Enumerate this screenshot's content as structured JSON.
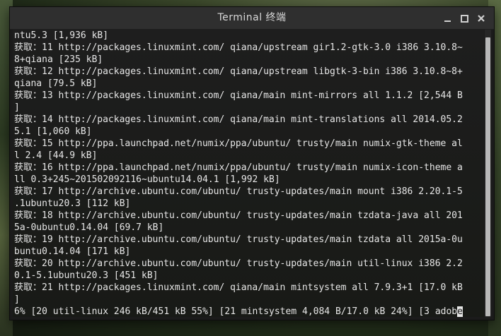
{
  "window": {
    "title": "Terminal 终端"
  },
  "terminal": {
    "lines": [
      "ntu5.3 [1,936 kB]",
      "获取：11 http://packages.linuxmint.com/ qiana/upstream gir1.2-gtk-3.0 i386 3.10.8~",
      "8+qiana [235 kB]",
      "获取：12 http://packages.linuxmint.com/ qiana/upstream libgtk-3-bin i386 3.10.8~8+",
      "qiana [79.5 kB]",
      "获取：13 http://packages.linuxmint.com/ qiana/main mint-mirrors all 1.1.2 [2,544 B",
      "]",
      "获取：14 http://packages.linuxmint.com/ qiana/main mint-translations all 2014.05.2",
      "5.1 [1,060 kB]",
      "获取：15 http://ppa.launchpad.net/numix/ppa/ubuntu/ trusty/main numix-gtk-theme al",
      "l 2.4 [44.9 kB]",
      "获取：16 http://ppa.launchpad.net/numix/ppa/ubuntu/ trusty/main numix-icon-theme a",
      "ll 0.3+245~201502092116~ubuntu14.04.1 [1,992 kB]",
      "获取：17 http://archive.ubuntu.com/ubuntu/ trusty-updates/main mount i386 2.20.1-5",
      ".1ubuntu20.3 [112 kB]",
      "获取：18 http://archive.ubuntu.com/ubuntu/ trusty-updates/main tzdata-java all 201",
      "5a-0ubuntu0.14.04 [69.7 kB]",
      "获取：19 http://archive.ubuntu.com/ubuntu/ trusty-updates/main tzdata all 2015a-0u",
      "buntu0.14.04 [171 kB]",
      "获取：20 http://archive.ubuntu.com/ubuntu/ trusty-updates/main util-linux i386 2.2",
      "0.1-5.1ubuntu20.3 [451 kB]",
      "获取：21 http://packages.linuxmint.com/ qiana/main mintsystem all 7.9.3+1 [17.0 kB",
      "]"
    ],
    "progress_line": "6% [20 util-linux 246 kB/451 kB 55%] [21 mintsystem 4,084 B/17.0 kB 24%] [3 adob",
    "cursor_char": "e"
  },
  "icons": {
    "minimize": "minimize-icon",
    "maximize": "maximize-icon",
    "close": "close-icon"
  }
}
